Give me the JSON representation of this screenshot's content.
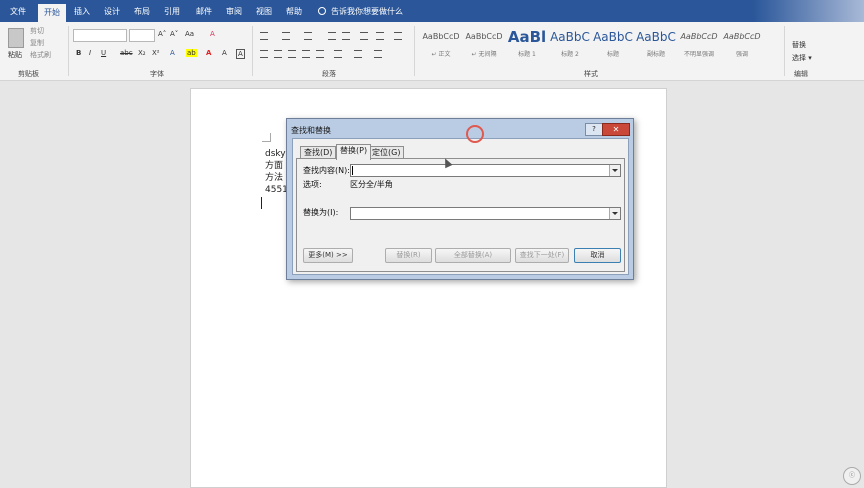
{
  "ribbon_tabs": [
    "文件",
    "开始",
    "插入",
    "设计",
    "布局",
    "引用",
    "邮件",
    "审阅",
    "视图",
    "帮助"
  ],
  "tell_me": "告诉我你想要做什么",
  "clipboard": {
    "paste": "粘贴",
    "cut": "剪切",
    "copy": "复制",
    "format_painter": "格式刷",
    "label": "剪贴板"
  },
  "font": {
    "bold": "B",
    "italic": "I",
    "underline": "U",
    "strike": "abc",
    "subscript": "X₂",
    "superscript": "X²",
    "grow": "A˄",
    "shrink": "A˅",
    "case": "Aa",
    "clear": "A",
    "font_color": "A",
    "label": "字体"
  },
  "paragraph": {
    "label": "段落"
  },
  "styles": {
    "items": [
      {
        "sample": "AaBbCcD",
        "name": "↵ 正文",
        "size": "small"
      },
      {
        "sample": "AaBbCcD",
        "name": "↵ 无间隔",
        "size": "small"
      },
      {
        "sample": "AaBl",
        "name": "标题 1",
        "size": "big"
      },
      {
        "sample": "AaBbC",
        "name": "标题 2",
        "size": "med"
      },
      {
        "sample": "AaBbC",
        "name": "标题",
        "size": "med"
      },
      {
        "sample": "AaBbC",
        "name": "副标题",
        "size": "med"
      },
      {
        "sample": "AaBbCcD",
        "name": "不明显强调",
        "size": "small"
      },
      {
        "sample": "AaBbCcD",
        "name": "强调",
        "size": "small"
      }
    ],
    "label": "样式"
  },
  "editing": {
    "replace": "替换",
    "select": "选择 ▾",
    "label": "编辑"
  },
  "document": {
    "lines": [
      "dsky",
      "方面",
      "方法",
      "4551"
    ]
  },
  "dialog": {
    "title": "查找和替换",
    "help": "?",
    "close": "✕",
    "tabs": [
      "查找(D)",
      "替换(P)",
      "定位(G)"
    ],
    "find_label": "查找内容(N):",
    "find_value": "",
    "options_label": "选项:",
    "options_value": "区分全/半角",
    "replace_label": "替换为(I):",
    "replace_value": "",
    "buttons": {
      "more": "更多(M) >>",
      "replace": "替换(R)",
      "replace_all": "全部替换(A)",
      "find_next": "查找下一处(F)",
      "cancel": "取消"
    }
  },
  "colors": {
    "ribbon_blue": "#2b579a",
    "ribbon_bg": "#f3f3f3",
    "dialog_frame": "#b9cce4",
    "close_red": "#c9483a",
    "highlight_yellow": "#ffff00",
    "font_red": "#e02020"
  }
}
